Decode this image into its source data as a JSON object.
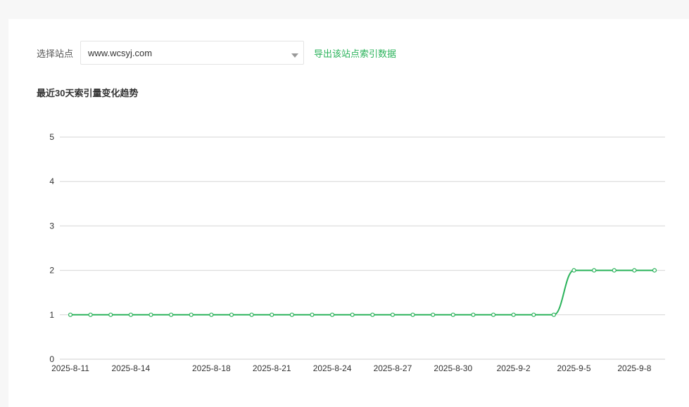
{
  "site_select": {
    "label": "选择站点",
    "value": "www.wcsyj.com"
  },
  "export_link": "导出该站点索引数据",
  "chart_title": "最近30天索引量变化趋势",
  "colors": {
    "accent": "#2bb35b",
    "grid": "#d6d6d6",
    "axis_text": "#333333"
  },
  "icons": {
    "dropdown": "caret-down-icon"
  },
  "chart_data": {
    "type": "line",
    "title": "最近30天索引量变化趋势",
    "xlabel": "",
    "ylabel": "",
    "ylim": [
      0,
      5
    ],
    "yticks": [
      0,
      1,
      2,
      3,
      4,
      5
    ],
    "grid": true,
    "x": [
      "2025-8-11",
      "2025-8-12",
      "2025-8-13",
      "2025-8-14",
      "2025-8-15",
      "2025-8-16",
      "2025-8-17",
      "2025-8-18",
      "2025-8-19",
      "2025-8-20",
      "2025-8-21",
      "2025-8-22",
      "2025-8-23",
      "2025-8-24",
      "2025-8-25",
      "2025-8-26",
      "2025-8-27",
      "2025-8-28",
      "2025-8-29",
      "2025-8-30",
      "2025-8-31",
      "2025-9-1",
      "2025-9-2",
      "2025-9-3",
      "2025-9-4",
      "2025-9-5",
      "2025-9-6",
      "2025-9-7",
      "2025-9-8",
      "2025-9-9"
    ],
    "xtick_labels": [
      "2025-8-11",
      "2025-8-14",
      "2025-8-18",
      "2025-8-21",
      "2025-8-24",
      "2025-8-27",
      "2025-8-30",
      "2025-9-2",
      "2025-9-5",
      "2025-9-8"
    ],
    "series": [
      {
        "values": [
          1,
          1,
          1,
          1,
          1,
          1,
          1,
          1,
          1,
          1,
          1,
          1,
          1,
          1,
          1,
          1,
          1,
          1,
          1,
          1,
          1,
          1,
          1,
          1,
          1,
          2,
          2,
          2,
          2,
          2
        ]
      }
    ]
  }
}
